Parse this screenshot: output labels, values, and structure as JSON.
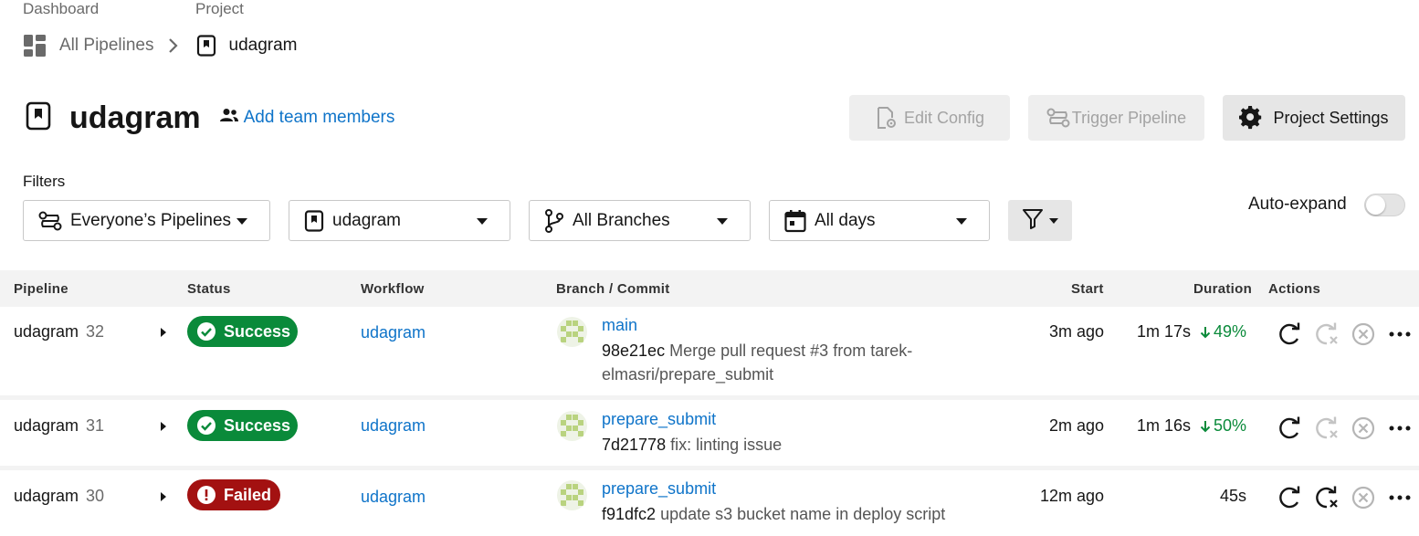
{
  "breadcrumb": {
    "label_dashboard": "Dashboard",
    "label_project": "Project",
    "all_pipelines": "All Pipelines",
    "project": "udagram"
  },
  "header": {
    "title": "udagram",
    "add_members": "Add team members",
    "edit_config": "Edit Config",
    "trigger_pipeline": "Trigger Pipeline",
    "project_settings": "Project Settings"
  },
  "filters": {
    "label": "Filters",
    "pipelines": "Everyone’s Pipelines",
    "project": "udagram",
    "branches": "All Branches",
    "days": "All days",
    "auto_expand": "Auto-expand",
    "auto_expand_on": false
  },
  "table": {
    "columns": [
      "Pipeline",
      "Status",
      "Workflow",
      "Branch / Commit",
      "Start",
      "Duration",
      "Actions"
    ],
    "rows": [
      {
        "pipeline": "udagram",
        "number": "32",
        "status": "Success",
        "workflow": "udagram",
        "branch": "main",
        "sha": "98e21ec",
        "message": "Merge pull request #3 from tarek-elmasri/prepare_submit",
        "start": "3m ago",
        "duration": "1m 17s",
        "delta": "49%"
      },
      {
        "pipeline": "udagram",
        "number": "31",
        "status": "Success",
        "workflow": "udagram",
        "branch": "prepare_submit",
        "sha": "7d21778",
        "message": "fix: linting issue",
        "start": "2m ago",
        "duration": "1m 16s",
        "delta": "50%"
      },
      {
        "pipeline": "udagram",
        "number": "30",
        "status": "Failed",
        "workflow": "udagram",
        "branch": "prepare_submit",
        "sha": "f91dfc2",
        "message": "update s3 bucket name in deploy script",
        "start": "12m ago",
        "duration": "45s",
        "delta": ""
      }
    ]
  },
  "colors": {
    "link": "#0f74c9",
    "success": "#0a8a3a",
    "failed": "#a31111"
  }
}
